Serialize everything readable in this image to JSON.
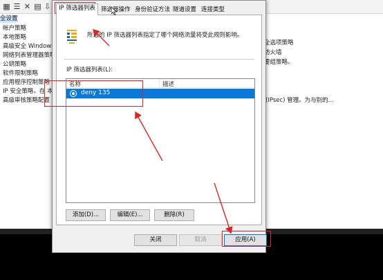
{
  "background_tree": {
    "items": [
      "全设置",
      "帐户策略",
      "本地策略",
      "高级安全 Windows",
      "网络列表管理器策略",
      "公钥策略",
      "软件限制策略",
      "应用程序控制策略",
      "IP 安全策略，在 本",
      "高级审核策略配置"
    ]
  },
  "background_right": {
    "items": [
      "全选项策略",
      "防火墙",
      "要组策略。",
      "(IPsec) 管理。为与别的..."
    ]
  },
  "dialog": {
    "tabs": [
      "IP 筛选器列表",
      "筛选器操作",
      "身份验证方法",
      "隧道设置",
      "连接类型"
    ],
    "description": "所选的 IP 筛选器列表指定了哪个网络流量将受此规则影响。",
    "list_label": "IP 筛选器列表(L):",
    "columns": [
      "名称",
      "描述"
    ],
    "rows": [
      {
        "name": "deny 135",
        "description": ""
      }
    ],
    "buttons": {
      "add": "添加(D)...",
      "edit": "编辑(E)...",
      "delete": "删除(R)"
    },
    "footer": {
      "close": "关闭",
      "cancel": "取消",
      "apply": "应用(A)"
    }
  },
  "colors": {
    "annotation": "#e22222",
    "selection": "#0a78d7"
  }
}
